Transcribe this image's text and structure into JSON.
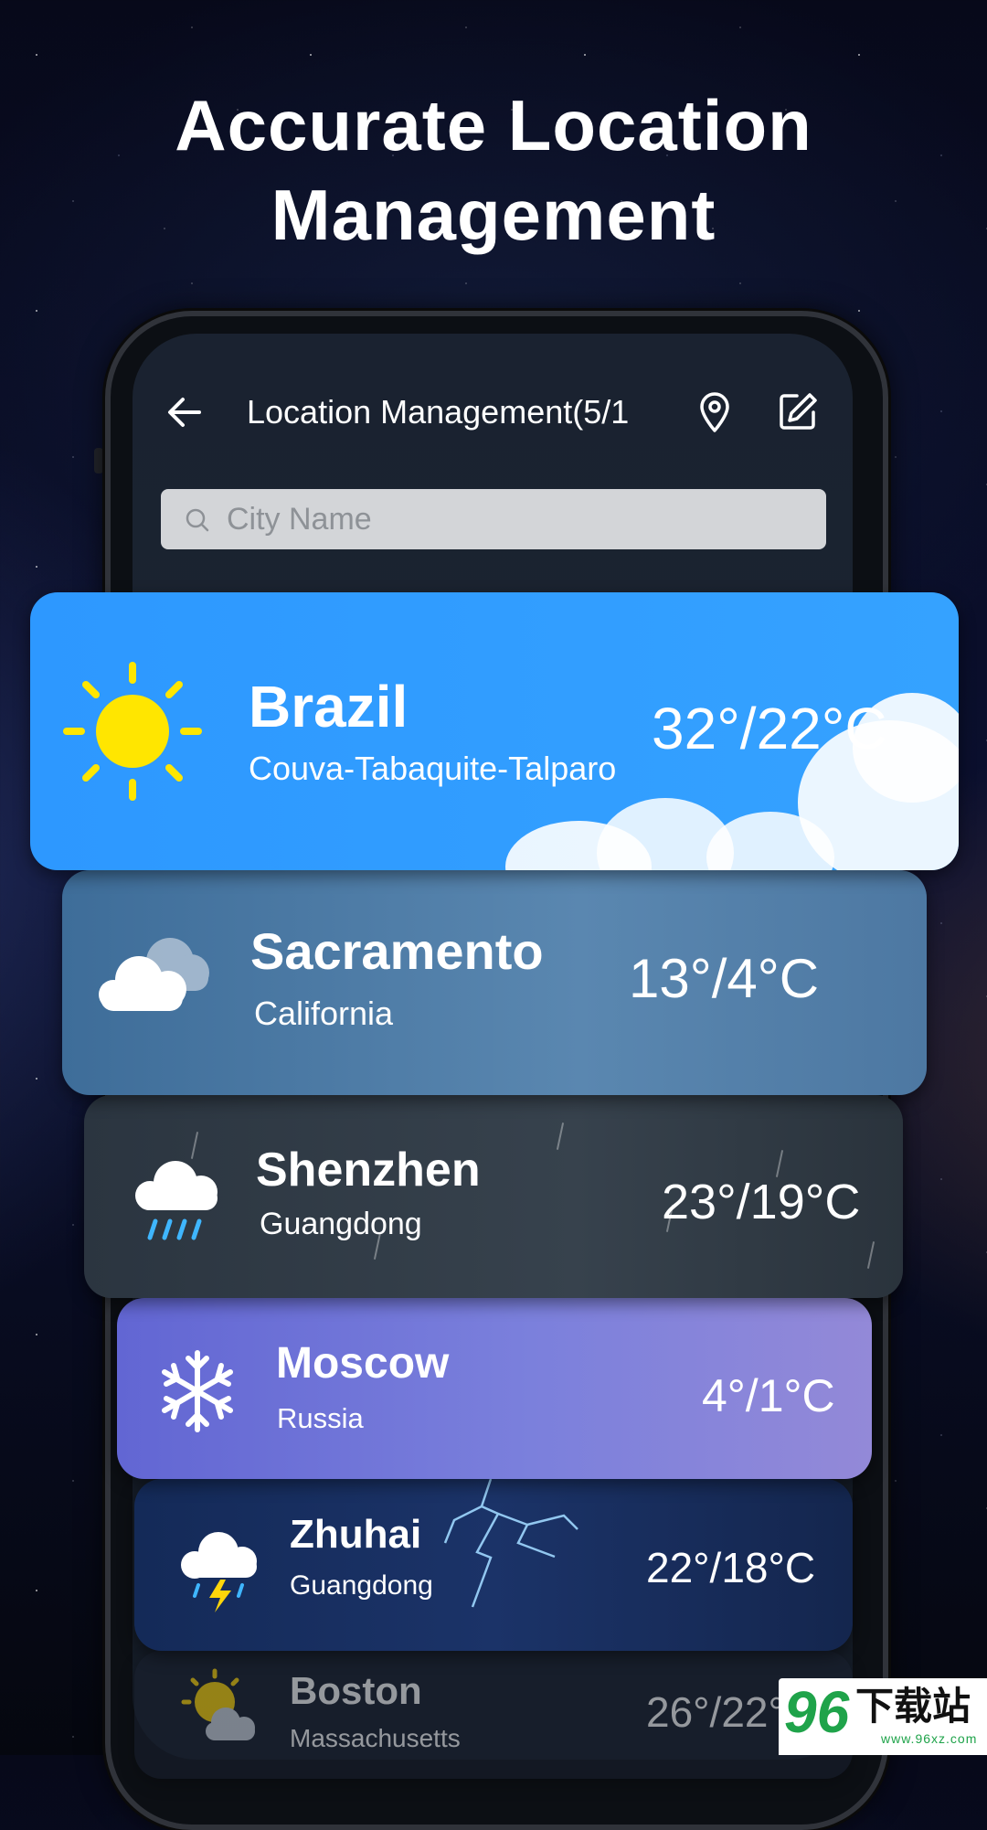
{
  "headline": "Accurate Location\nManagement",
  "nav": {
    "title": "Location Management(5/1",
    "back_icon": "arrow-left-icon",
    "location_icon": "map-pin-icon",
    "edit_icon": "edit-icon"
  },
  "search": {
    "placeholder": "City Name"
  },
  "locations": [
    {
      "city": "Brazil",
      "region": "Couva-Tabaquite-Talparo",
      "temp": "32°/22°C",
      "icon": "sun-icon"
    },
    {
      "city": "Sacramento",
      "region": "California",
      "temp": "13°/4°C",
      "icon": "cloudy-icon"
    },
    {
      "city": "Shenzhen",
      "region": "Guangdong",
      "temp": "23°/19°C",
      "icon": "rain-icon"
    },
    {
      "city": "Moscow",
      "region": "Russia",
      "temp": "4°/1°C",
      "icon": "snowflake-icon"
    },
    {
      "city": "Zhuhai",
      "region": "Guangdong",
      "temp": "22°/18°C",
      "icon": "thunderstorm-icon"
    },
    {
      "city": "Boston",
      "region": "Massachusetts",
      "temp": "26°/22°",
      "icon": "partly-sunny-icon"
    }
  ],
  "watermark": {
    "number": "96",
    "text": "下载站",
    "url": "www.96xz.com"
  },
  "colors": {
    "card_sunny": "#2d98ff",
    "card_moscow": "#7b80dc",
    "search_bg": "#d3d5d8"
  }
}
